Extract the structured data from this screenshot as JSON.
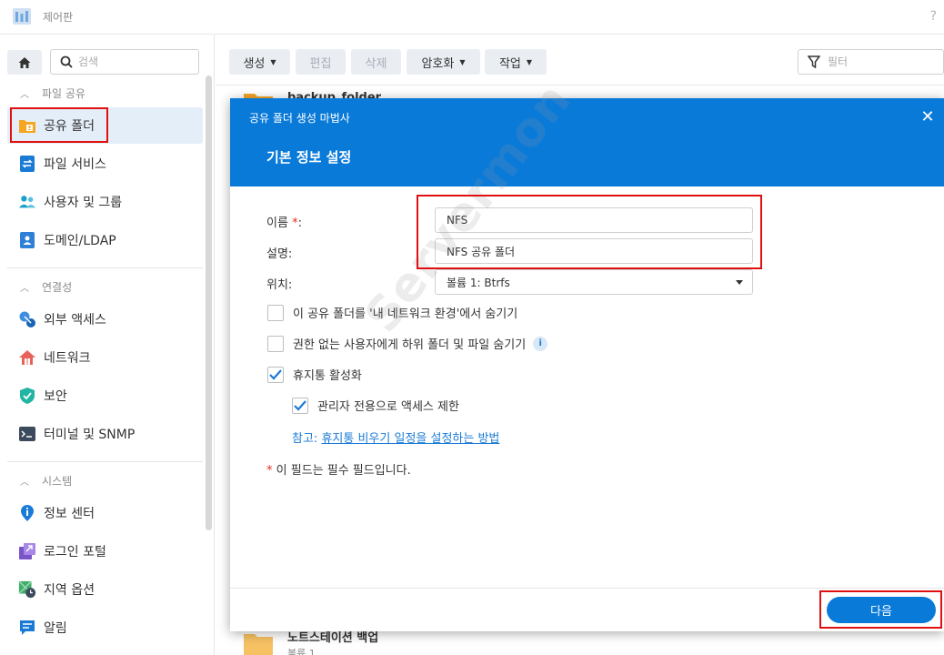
{
  "app": {
    "title": "제어판",
    "help": "?"
  },
  "sidebar": {
    "search_placeholder": "검색",
    "sections": [
      {
        "label": "파일 공유",
        "items": [
          {
            "label": "공유 폴더",
            "icon": "shared-folder-icon",
            "active": true
          },
          {
            "label": "파일 서비스",
            "icon": "file-services-icon"
          },
          {
            "label": "사용자 및 그룹",
            "icon": "users-group-icon"
          },
          {
            "label": "도메인/LDAP",
            "icon": "domain-ldap-icon"
          }
        ]
      },
      {
        "label": "연결성",
        "items": [
          {
            "label": "외부 액세스",
            "icon": "external-access-icon"
          },
          {
            "label": "네트워크",
            "icon": "network-icon"
          },
          {
            "label": "보안",
            "icon": "security-shield-icon"
          },
          {
            "label": "터미널 및 SNMP",
            "icon": "terminal-icon"
          }
        ]
      },
      {
        "label": "시스템",
        "items": [
          {
            "label": "정보 센터",
            "icon": "info-center-icon"
          },
          {
            "label": "로그인 포털",
            "icon": "login-portal-icon"
          },
          {
            "label": "지역 옵션",
            "icon": "regional-options-icon"
          },
          {
            "label": "알림",
            "icon": "notification-icon"
          }
        ]
      }
    ]
  },
  "toolbar": {
    "create": "생성",
    "edit": "편집",
    "delete": "삭제",
    "encryption": "암호화",
    "action": "작업",
    "filter_placeholder": "필터"
  },
  "background_list": {
    "row1_title": "backup_folder",
    "row2_title": "노트스테이션 백업",
    "row2_sub": "볼륨 1"
  },
  "modal": {
    "title": "공유 폴더 생성 마법사",
    "subtitle": "기본 정보 설정",
    "name_label": "이름",
    "required_mark": "*",
    "name_suffix": ":",
    "name_value": "NFS",
    "desc_label": "설명:",
    "desc_value": "NFS 공유 폴더",
    "location_label": "위치:",
    "location_value": "볼륨 1:  Btrfs",
    "cb_hide_network": "이 공유 폴더를 '내 네트워크 환경'에서 숨기기",
    "cb_hide_unauth": "권한 없는 사용자에게 하위 폴더 및 파일 숨기기",
    "cb_recycle": "휴지통 활성화",
    "cb_admin_only": "관리자 전용으로 액세스 제한",
    "note_prefix": "참고:",
    "note_link": "휴지통 비우기 일정을 설정하는 방법",
    "required_note": "이 필드는 필수 필드입니다.",
    "next": "다음"
  },
  "watermark": "Servermon",
  "colors": {
    "accent": "#0a7ad9",
    "highlight": "#e01010"
  }
}
